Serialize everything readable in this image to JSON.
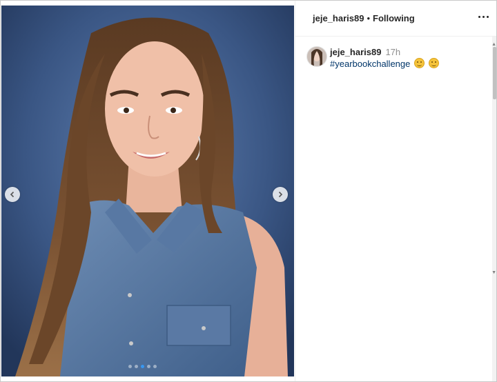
{
  "header": {
    "username": "jeje_haris89",
    "separator": "•",
    "follow_status": "Following"
  },
  "comment": {
    "username": "jeje_haris89",
    "time": "17h",
    "hashtag": "#yearbookchallenge"
  },
  "carousel": {
    "total_slides": 5,
    "active_index": 2
  },
  "icons": {
    "prev": "chevron-left-icon",
    "next": "chevron-right-icon",
    "more": "more-options-icon"
  },
  "colors": {
    "dot_active": "#3897f0",
    "hashtag": "#003569",
    "text": "#262626",
    "muted": "#8e8e8e"
  }
}
